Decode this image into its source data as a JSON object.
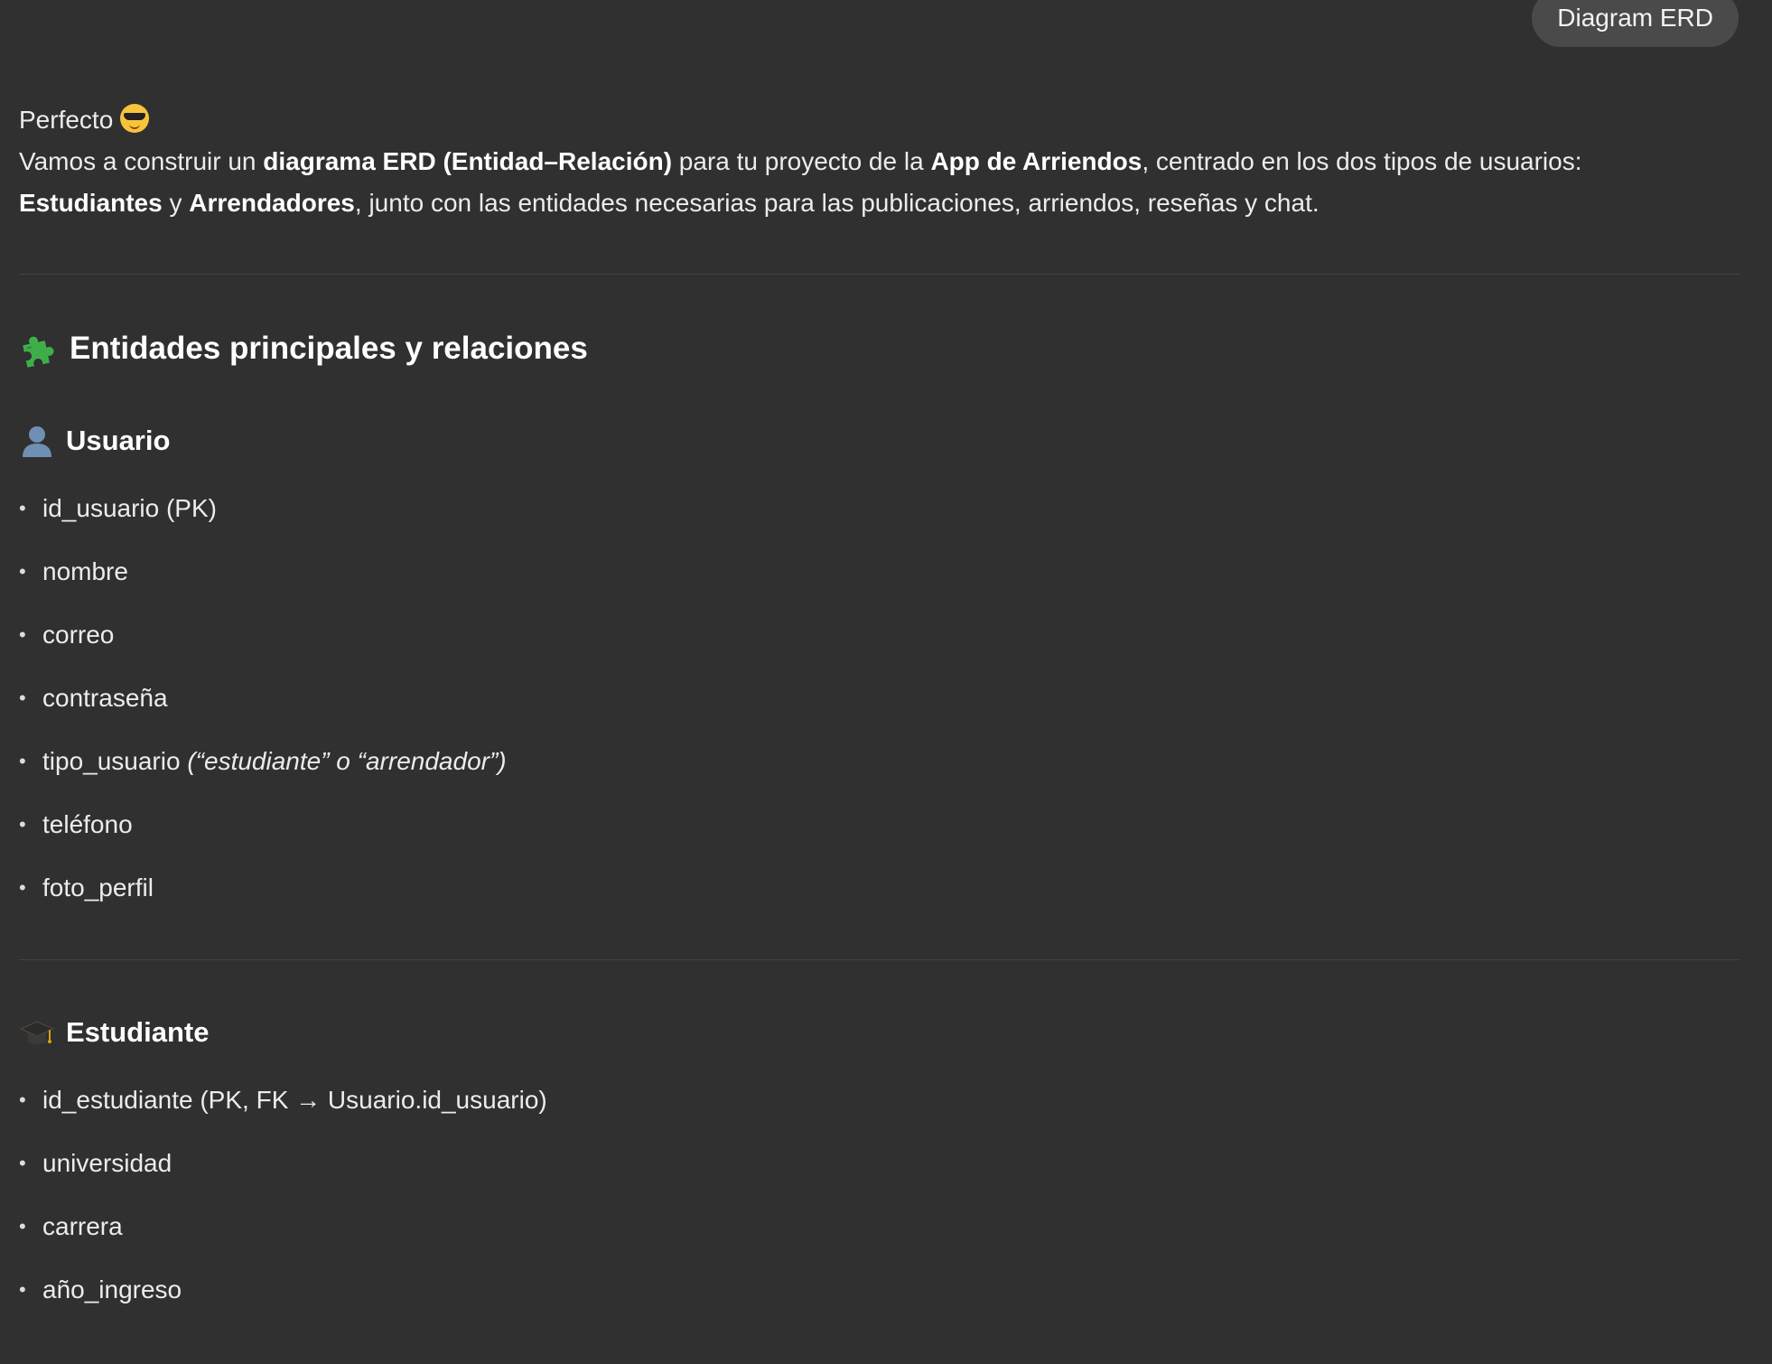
{
  "user_message": {
    "text": "Diagram ERD"
  },
  "assistant": {
    "greeting": "Perfecto",
    "greeting_emoji": "smiling-face-with-sunglasses-icon",
    "intro": {
      "p1": "Vamos a construir un ",
      "b1": "diagrama ERD (Entidad–Relación)",
      "p2": " para tu proyecto de la ",
      "b2": "App de Arriendos",
      "p3": ", centrado en los dos tipos de usuarios:",
      "b3": "Estudiantes",
      "p4": " y ",
      "b4": "Arrendadores",
      "p5": ", junto con las entidades necesarias para las publicaciones, arriendos, reseñas y chat."
    },
    "section": {
      "icon": "puzzle-piece-icon",
      "title": "Entidades principales y relaciones"
    },
    "entities": [
      {
        "icon": "user-silhouette-icon",
        "name": "Usuario",
        "fields": [
          {
            "text": "id_usuario (PK)"
          },
          {
            "text": "nombre"
          },
          {
            "text": "correo"
          },
          {
            "text": "contraseña"
          },
          {
            "text": "tipo_usuario ",
            "note": "(“estudiante” o “arrendador”)"
          },
          {
            "text": "teléfono"
          },
          {
            "text": "foto_perfil"
          }
        ]
      },
      {
        "icon": "graduation-cap-icon",
        "name": "Estudiante",
        "fields": [
          {
            "text": "id_estudiante (PK, FK → Usuario.id_usuario)"
          },
          {
            "text": "universidad"
          },
          {
            "text": "carrera"
          },
          {
            "text": "año_ingreso"
          }
        ]
      }
    ]
  },
  "colors": {
    "background": "#303030",
    "bubble": "#4a4a4a",
    "text": "#ececec",
    "divider": "#444444"
  }
}
